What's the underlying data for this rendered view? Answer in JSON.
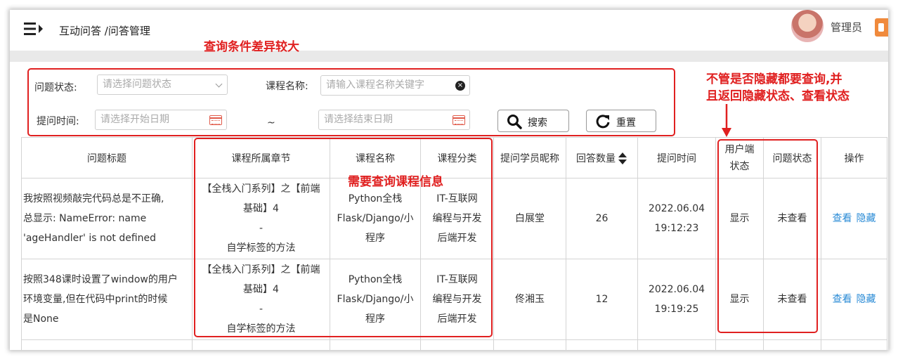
{
  "header": {
    "breadcrumb": "互动问答 /问答管理",
    "username": "管理员"
  },
  "filters": {
    "status_label": "问题状态:",
    "status_placeholder": "请选择问题状态",
    "course_label": "课程名称:",
    "course_placeholder": "请输入课程名称关键字",
    "time_label": "提问时间:",
    "start_placeholder": "请选择开始日期",
    "range_sep": "~",
    "end_placeholder": "请选择结束日期",
    "search_label": "搜索",
    "reset_label": "重置"
  },
  "table": {
    "headers": {
      "title": "问题标题",
      "chapter": "课程所属章节",
      "course": "课程名称",
      "category": "课程分类",
      "student": "提问学员昵称",
      "answers": "回答数量",
      "time": "提问时间",
      "user_status_1": "用户端",
      "user_status_2": "状态",
      "status": "问题状态",
      "actions": "操作"
    },
    "rows": [
      {
        "title_1": "我按照视频敲完代码总是不正确,",
        "title_2": "总显示: NameError: name",
        "title_3": "'ageHandler' is not defined",
        "chapter_1": "【全栈入门系列】之【前端",
        "chapter_2": "基础】4",
        "chapter_3": "-",
        "chapter_4": "自学标签的方法",
        "course_1": "Python全栈",
        "course_2": "Flask/Django/小",
        "course_3": "程序",
        "category_1": "IT-互联网",
        "category_2": "编程与开发",
        "category_3": "后端开发",
        "student": "白展堂",
        "answers": "26",
        "date": "2022.06.04",
        "time": "19:12:23",
        "user_status": "显示",
        "status": "未查看",
        "view": "查看",
        "hide": "隐藏"
      },
      {
        "title_1": "按照348课时设置了window的用户",
        "title_2": "环境变量,但在代码中print的时候",
        "title_3": "是None",
        "chapter_1": "【全栈入门系列】之【前端",
        "chapter_2": "基础】4",
        "chapter_3": "-",
        "chapter_4": "自学标签的方法",
        "course_1": "Python全栈",
        "course_2": "Flask/Django/小",
        "course_3": "程序",
        "category_1": "IT-互联网",
        "category_2": "编程与开发",
        "category_3": "后端开发",
        "student": "佟湘玉",
        "answers": "12",
        "date": "2022.06.04",
        "time": "19:19:25",
        "user_status": "显示",
        "status": "未查看",
        "view": "查看",
        "hide": "隐藏"
      }
    ]
  },
  "annotations": {
    "filters_note": "查询条件差异较大",
    "course_note": "需要查询课程信息",
    "status_note_1": "不管是否隐藏都要查询,并",
    "status_note_2": "且返回隐藏状态、查看状态"
  },
  "colors": {
    "annotation": "#e02020",
    "link": "#2a8bd6",
    "calendar_icon": "#e05a4a"
  }
}
